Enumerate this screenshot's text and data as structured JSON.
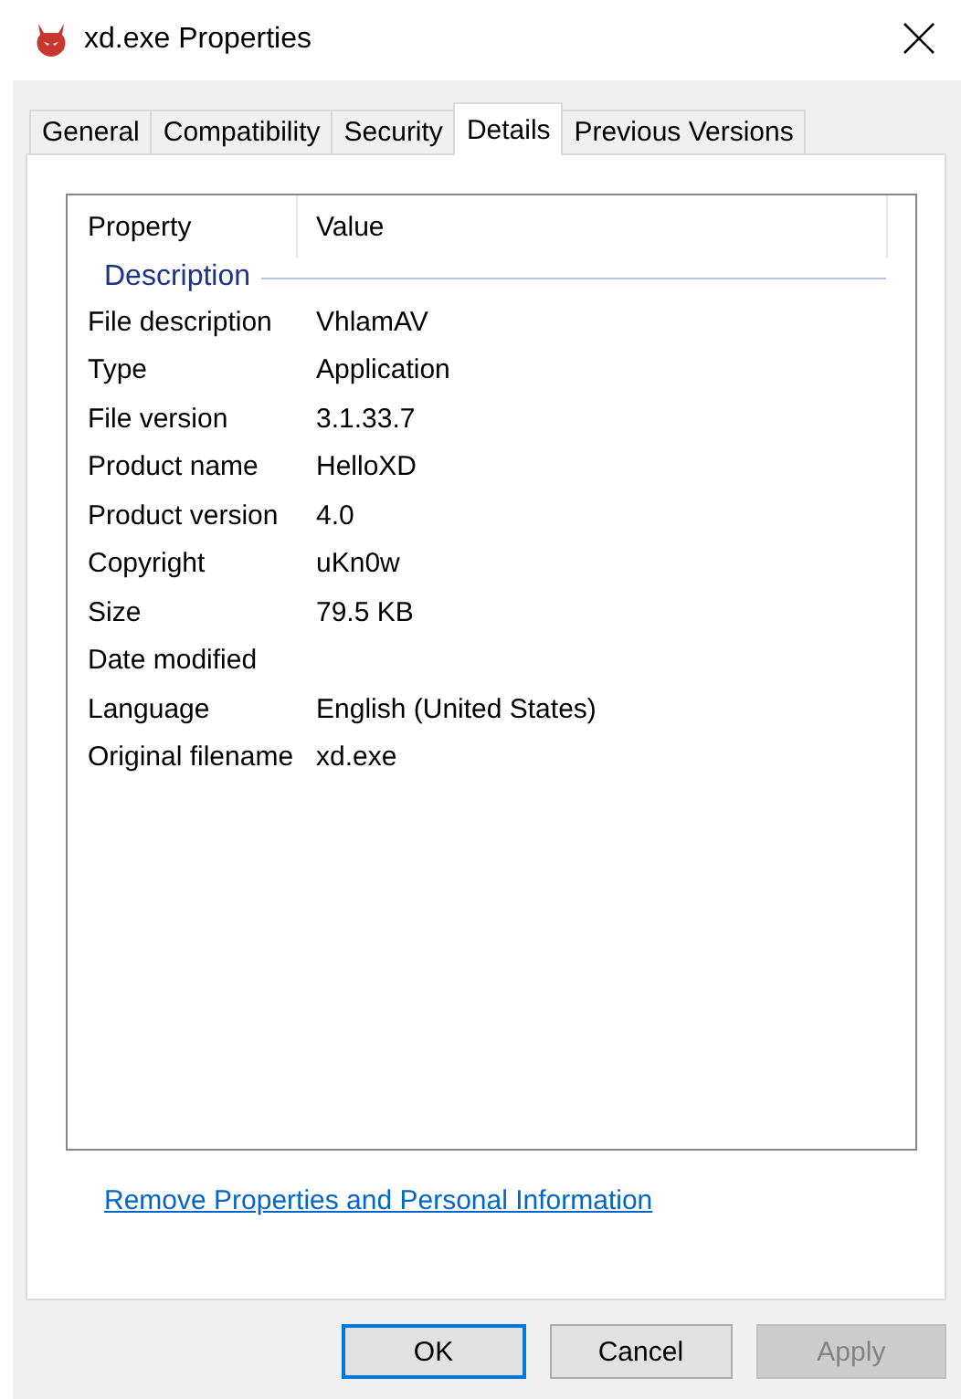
{
  "window": {
    "title": "xd.exe Properties"
  },
  "tabs": [
    {
      "label": "General",
      "selected": false
    },
    {
      "label": "Compatibility",
      "selected": false
    },
    {
      "label": "Security",
      "selected": false
    },
    {
      "label": "Details",
      "selected": true
    },
    {
      "label": "Previous Versions",
      "selected": false
    }
  ],
  "table": {
    "columns": [
      "Property",
      "Value"
    ],
    "group": "Description",
    "rows": [
      {
        "property": "File description",
        "value": "VhlamAV"
      },
      {
        "property": "Type",
        "value": "Application"
      },
      {
        "property": "File version",
        "value": "3.1.33.7"
      },
      {
        "property": "Product name",
        "value": "HelloXD"
      },
      {
        "property": "Product version",
        "value": "4.0"
      },
      {
        "property": "Copyright",
        "value": "uKn0w"
      },
      {
        "property": "Size",
        "value": "79.5 KB"
      },
      {
        "property": "Date modified"
      },
      {
        "property": "Language",
        "value": "English (United States)"
      },
      {
        "property": "Original filename",
        "value": "xd.exe"
      }
    ]
  },
  "link": "Remove Properties and Personal Information",
  "buttons": [
    {
      "label": "OK",
      "default": true,
      "disabled": false
    },
    {
      "label": "Cancel",
      "default": false,
      "disabled": false
    },
    {
      "label": "Apply",
      "default": false,
      "disabled": true
    }
  ]
}
